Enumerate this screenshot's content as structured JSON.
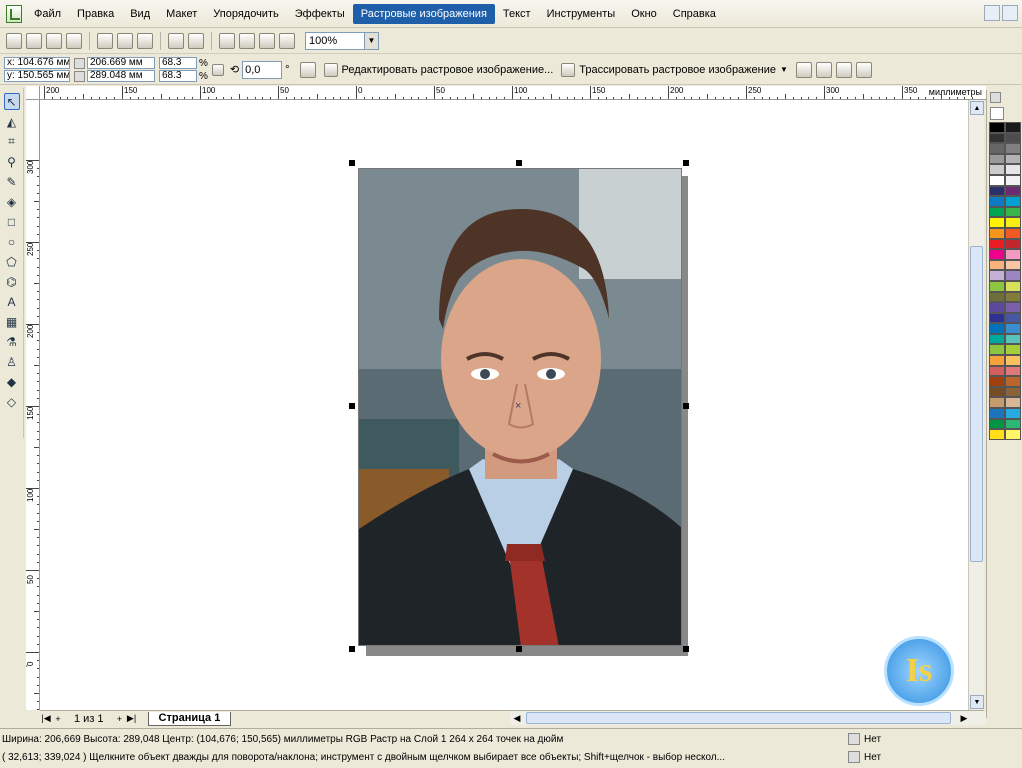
{
  "menu": [
    "Файл",
    "Правка",
    "Вид",
    "Макет",
    "Упорядочить",
    "Эффекты",
    "Растровые изображения",
    "Текст",
    "Инструменты",
    "Окно",
    "Справка"
  ],
  "toolbar": {
    "zoom_value": "100%"
  },
  "property_bar": {
    "x": "x: 104.676 мм",
    "y": "y: 150.565 мм",
    "width": "206.669 мм",
    "height": "289.048 мм",
    "scale_x": "68.3",
    "scale_y": "68.3",
    "percent": "%",
    "angle": "0,0",
    "angle_unit": "°",
    "edit_bitmap_label": "Редактировать растровое изображение...",
    "trace_bitmap_label": "Трассировать растровое изображение"
  },
  "ruler": {
    "h_labels": [
      "200",
      "150",
      "100",
      "50",
      "0",
      "50",
      "100",
      "150",
      "200",
      "250",
      "300",
      "350"
    ],
    "v_labels": [
      "300",
      "250",
      "200",
      "150",
      "100",
      "50",
      "0"
    ],
    "units": "миллиметры"
  },
  "watermark_text": "Is",
  "pagebar": {
    "count": "1 из 1",
    "page_tab": "Страница 1"
  },
  "status": {
    "line1": "Ширина: 206,669  Высота: 289,048  Центр: (104,676; 150,565)  миллиметры        RGB Растр на Слой 1 264 x 264 точек на дюйм",
    "line2": "( 32,613; 339,024 )      Щелкните объект дважды для поворота/наклона; инструмент с двойным щелчком выбирает все объекты; Shift+щелчок - выбор нескол...",
    "fill": "Нет",
    "outline": "Нет"
  },
  "palette_colors": [
    "#000000",
    "#1a1a1a",
    "#333333",
    "#4d4d4d",
    "#666666",
    "#808080",
    "#999999",
    "#b3b3b3",
    "#cccccc",
    "#e6e6e6",
    "#ffffff",
    "#f2f2f2",
    "#2b2f6b",
    "#6b2b70",
    "#0e7ac4",
    "#00a0d0",
    "#00a651",
    "#39b54a",
    "#fff200",
    "#f7ec13",
    "#f7941d",
    "#f15a24",
    "#ed1c24",
    "#c1272d",
    "#ec008c",
    "#f49ac1",
    "#f9b27f",
    "#fbc4a5",
    "#c4b2d6",
    "#9b86c1",
    "#8dc63f",
    "#d7e05a",
    "#6d6e3a",
    "#857b38",
    "#5b4a9c",
    "#7a5fa8",
    "#2e3192",
    "#4757a5",
    "#0072bc",
    "#3a8ed0",
    "#00a99d",
    "#58c3b6",
    "#8bc53f",
    "#a6ce39",
    "#f6a23a",
    "#f9c05f",
    "#d35f5f",
    "#e07a7a",
    "#a0410d",
    "#b8662b",
    "#754c24",
    "#8c6239",
    "#c69c6d",
    "#d8b796",
    "#1b75bb",
    "#27aae1",
    "#009444",
    "#2bb673",
    "#ffde17",
    "#fff568"
  ]
}
